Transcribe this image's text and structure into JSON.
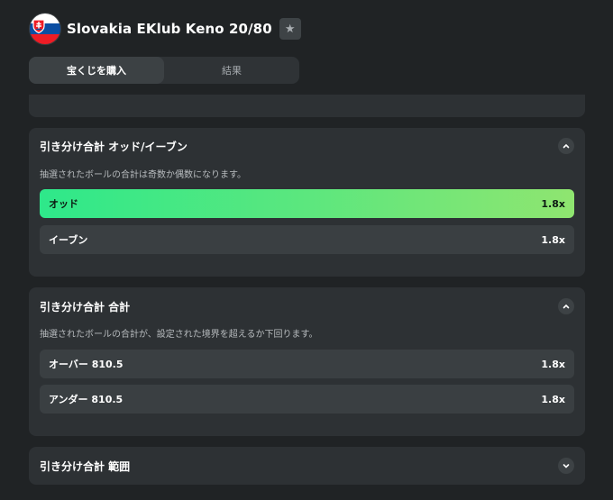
{
  "header": {
    "title": "Slovakia EKlub Keno 20/80",
    "flag_icon": "slovakia-flag-icon",
    "star_icon": "star-icon"
  },
  "tabs": [
    {
      "label": "宝くじを購入",
      "active": true
    },
    {
      "label": "結果",
      "active": false
    }
  ],
  "markets": [
    {
      "title": "引き分け合計 オッド/イーブン",
      "description": "抽選されたボールの合計は奇数か偶数になります。",
      "expanded": true,
      "options": [
        {
          "label": "オッド",
          "odds": "1.8x",
          "selected": true
        },
        {
          "label": "イーブン",
          "odds": "1.8x",
          "selected": false
        }
      ]
    },
    {
      "title": "引き分け合計 合計",
      "description": "抽選されたボールの合計が、設定された境界を超えるか下回ります。",
      "expanded": true,
      "options": [
        {
          "label": "オーバー 810.5",
          "odds": "1.8x",
          "selected": false
        },
        {
          "label": "アンダー 810.5",
          "odds": "1.8x",
          "selected": false
        }
      ]
    },
    {
      "title": "引き分け合計 範囲",
      "expanded": false
    }
  ],
  "colors": {
    "background": "#202325",
    "card": "#2d3134",
    "row": "#3a3f42",
    "selected_start": "#2ee88a",
    "selected_end": "#8fe570"
  }
}
